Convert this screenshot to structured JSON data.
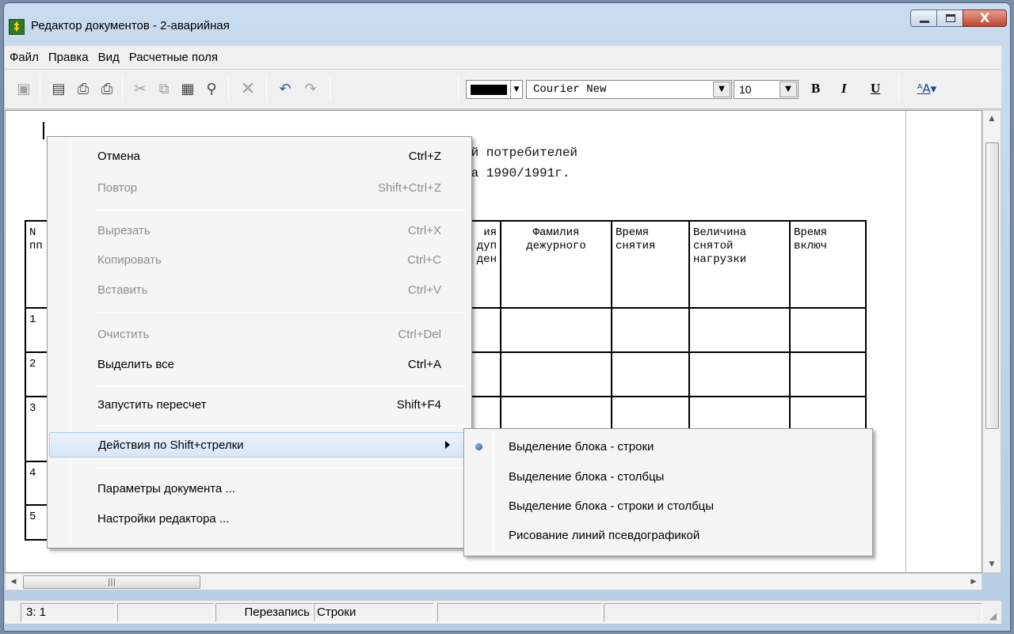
{
  "window": {
    "title": "Редактор документов - 2-аварийная",
    "close_glyph": "X"
  },
  "menubar": {
    "items": [
      "Файл",
      "Правка",
      "Вид",
      "Расчетные поля"
    ]
  },
  "toolbar": {
    "font_name": "Courier New",
    "font_size": "10",
    "bold": "B",
    "italic": "I",
    "underline": "U",
    "text_color": "#000000"
  },
  "document": {
    "lines": [
      "ий потребителей",
      "на 1990/1991г."
    ],
    "table": {
      "col1_header_fragment": [
        "N",
        "пп"
      ],
      "col4_header_fragment": [
        "ия",
        "дуп",
        "ден"
      ],
      "headers": [
        [
          "Фамилия",
          "дежурного"
        ],
        [
          "Время",
          "снятия"
        ],
        [
          "Величина",
          "снятой",
          "нагрузки"
        ],
        [
          "Время",
          "включ"
        ]
      ],
      "row_numbers": [
        "1",
        "2",
        "3",
        "4",
        "5"
      ]
    }
  },
  "context_menu": {
    "items": [
      {
        "label": "Отмена",
        "shortcut": "Ctrl+Z",
        "enabled": true
      },
      {
        "label": "Повтор",
        "shortcut": "Shift+Ctrl+Z",
        "enabled": false
      },
      {
        "label": "Вырезать",
        "shortcut": "Ctrl+X",
        "enabled": false
      },
      {
        "label": "Копировать",
        "shortcut": "Ctrl+C",
        "enabled": false
      },
      {
        "label": "Вставить",
        "shortcut": "Ctrl+V",
        "enabled": false
      },
      {
        "label": "Очистить",
        "shortcut": "Ctrl+Del",
        "enabled": false
      },
      {
        "label": "Выделить все",
        "shortcut": "Ctrl+A",
        "enabled": true
      },
      {
        "label": "Запустить пересчет",
        "shortcut": "Shift+F4",
        "enabled": true
      },
      {
        "label": "Действия по Shift+стрелки",
        "shortcut": "",
        "enabled": true
      },
      {
        "label": "Параметры документа ...",
        "shortcut": "",
        "enabled": true
      },
      {
        "label": "Настройки редактора ...",
        "shortcut": "",
        "enabled": true
      }
    ]
  },
  "submenu": {
    "items": [
      {
        "label": "Выделение блока - строки",
        "checked": true
      },
      {
        "label": "Выделение блока - столбцы",
        "checked": false
      },
      {
        "label": "Выделение блока - строки и столбцы",
        "checked": false
      },
      {
        "label": "Рисование линий псевдографикой",
        "checked": false
      }
    ]
  },
  "statusbar": {
    "position": "3: 1",
    "mode": "Перезапись",
    "selection_mode": "Строки"
  }
}
